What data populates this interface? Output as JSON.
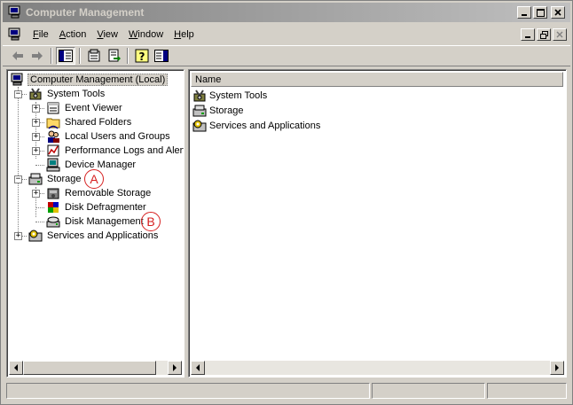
{
  "window": {
    "title": "Computer Management"
  },
  "menu": {
    "items": [
      {
        "accel": "F",
        "rest": "ile"
      },
      {
        "accel": "A",
        "rest": "ction"
      },
      {
        "accel": "V",
        "rest": "iew"
      },
      {
        "accel": "W",
        "rest": "indow"
      },
      {
        "accel": "H",
        "rest": "elp"
      }
    ]
  },
  "tree": {
    "root": "Computer Management (Local)",
    "system_tools": "System Tools",
    "event_viewer": "Event Viewer",
    "shared_folders": "Shared Folders",
    "local_users": "Local Users and Groups",
    "perf_logs": "Performance Logs and Alerts",
    "device_manager": "Device Manager",
    "storage": "Storage",
    "removable_storage": "Removable Storage",
    "disk_defrag": "Disk Defragmenter",
    "disk_mgmt": "Disk Management",
    "services_apps": "Services and Applications",
    "expand_minus": "−",
    "expand_plus": "+"
  },
  "callouts": {
    "a": "A",
    "b": "B"
  },
  "list": {
    "column_name": "Name",
    "rows": [
      "System Tools",
      "Storage",
      "Services and Applications"
    ]
  },
  "colors": {
    "chrome": "#d4d0c8",
    "callout": "#d62020"
  }
}
